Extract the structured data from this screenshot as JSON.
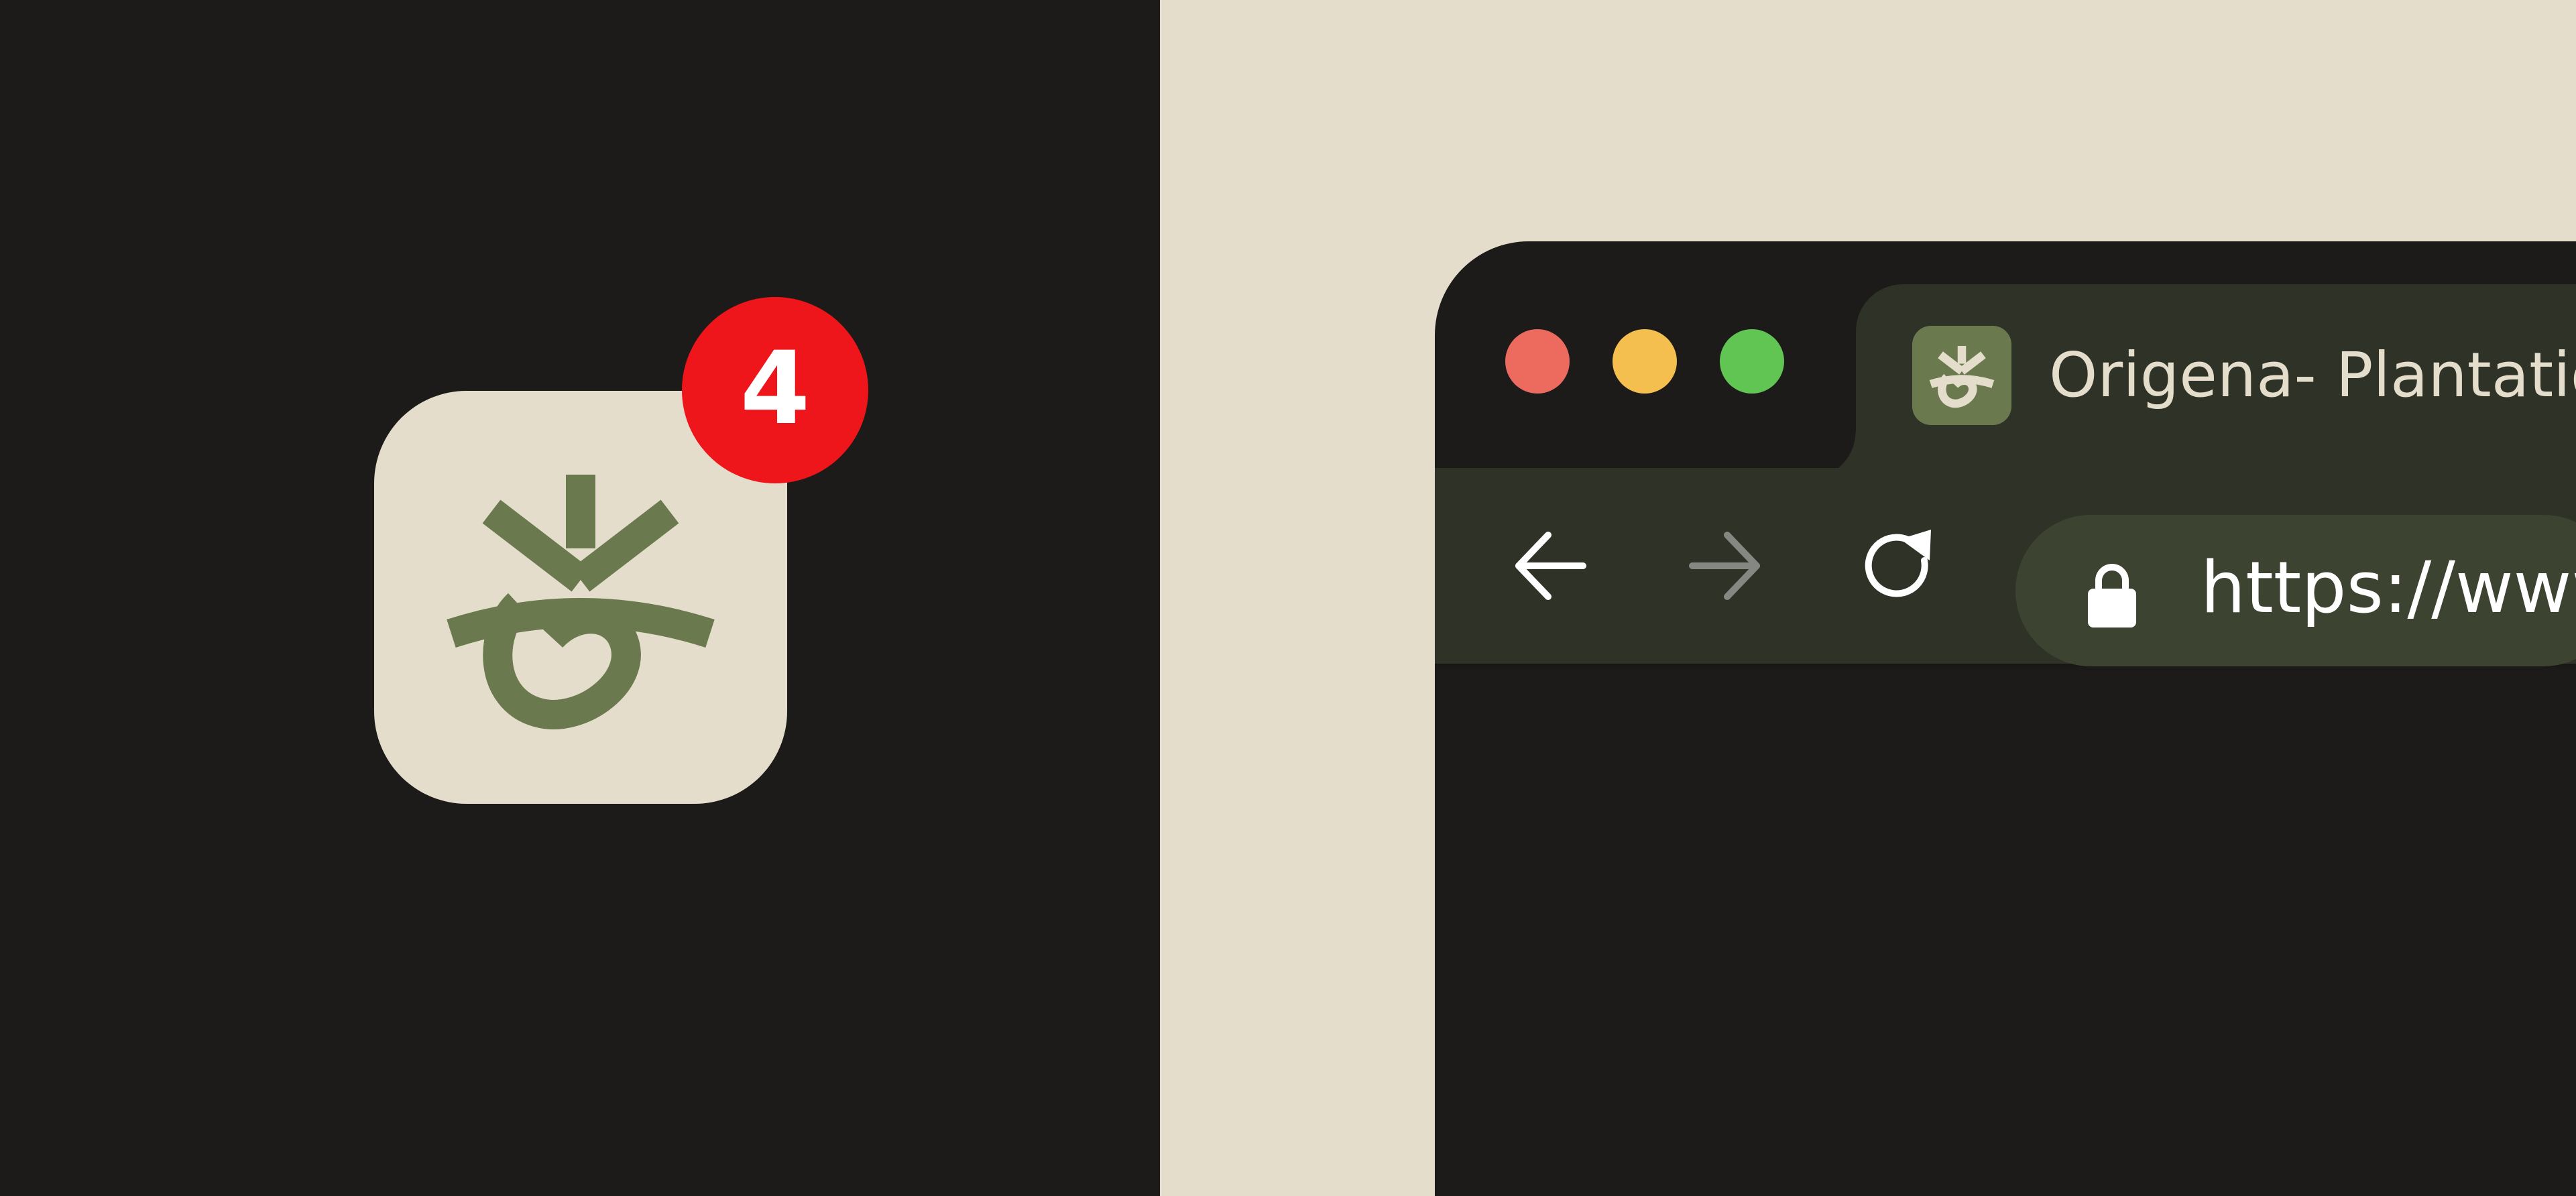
{
  "app_icon": {
    "icon": "origena-plant-logo-icon",
    "tile_color": "#e4ddcb",
    "glyph_color": "#6b7a4e",
    "badge": {
      "count": "4",
      "color": "#ee161a"
    }
  },
  "browser": {
    "window_controls": [
      "close",
      "minimize",
      "maximize"
    ],
    "tab": {
      "favicon": "origena-plant-logo-icon",
      "title": "Origena- Plantatio"
    },
    "toolbar": {
      "back_icon": "arrow-left-icon",
      "forward_icon": "arrow-right-icon",
      "reload_icon": "reload-icon"
    },
    "address_bar": {
      "lock_icon": "lock-icon",
      "url": "https://www"
    }
  },
  "colors": {
    "dark_background": "#1c1b19",
    "cream_background": "#e4ddcb",
    "toolbar": "#2f3327",
    "address_bar": "#3c4330"
  }
}
